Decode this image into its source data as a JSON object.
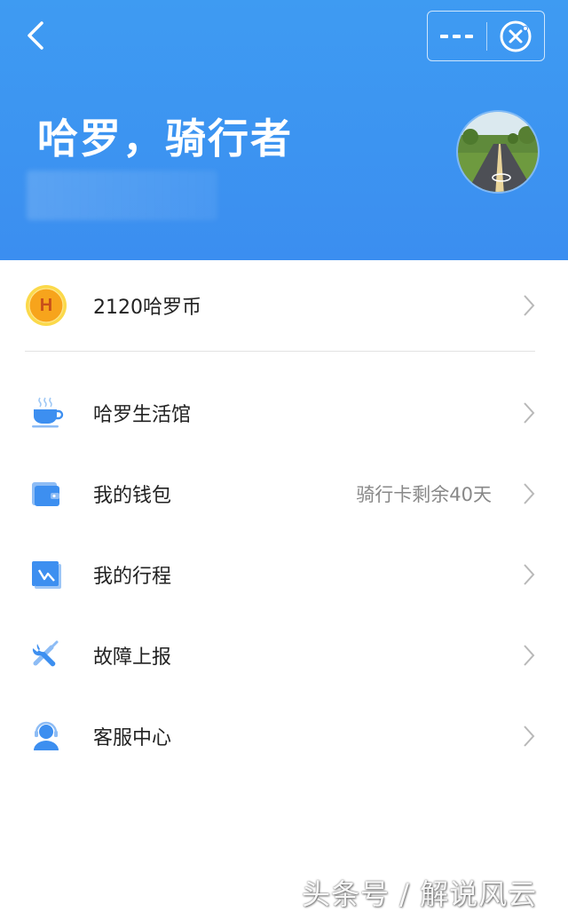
{
  "header": {
    "greeting": "哈罗，骑行者",
    "back_icon": "chevron-left-icon",
    "more_icon": "more-dots-icon",
    "close_icon": "close-target-icon",
    "gradient_top": "#3e9bf2",
    "gradient_bottom": "#3b8ef0"
  },
  "coins": {
    "label": "2120哈罗币",
    "icon_letter": "H",
    "icon": "coin-icon"
  },
  "menu": [
    {
      "label": "哈罗生活馆",
      "sub": "",
      "icon": "coffee-cup-icon"
    },
    {
      "label": "我的钱包",
      "sub": "骑行卡剩余40天",
      "icon": "wallet-icon"
    },
    {
      "label": "我的行程",
      "sub": "",
      "icon": "trip-chart-icon"
    },
    {
      "label": "故障上报",
      "sub": "",
      "icon": "wrench-screwdriver-icon"
    },
    {
      "label": "客服中心",
      "sub": "",
      "icon": "customer-service-icon"
    }
  ],
  "watermark": "头条号 / 解说风云",
  "colors": {
    "accent_blue": "#3d8ff0",
    "coin_orange": "#f7a41c",
    "text_primary": "#222222",
    "text_secondary": "#888888"
  }
}
